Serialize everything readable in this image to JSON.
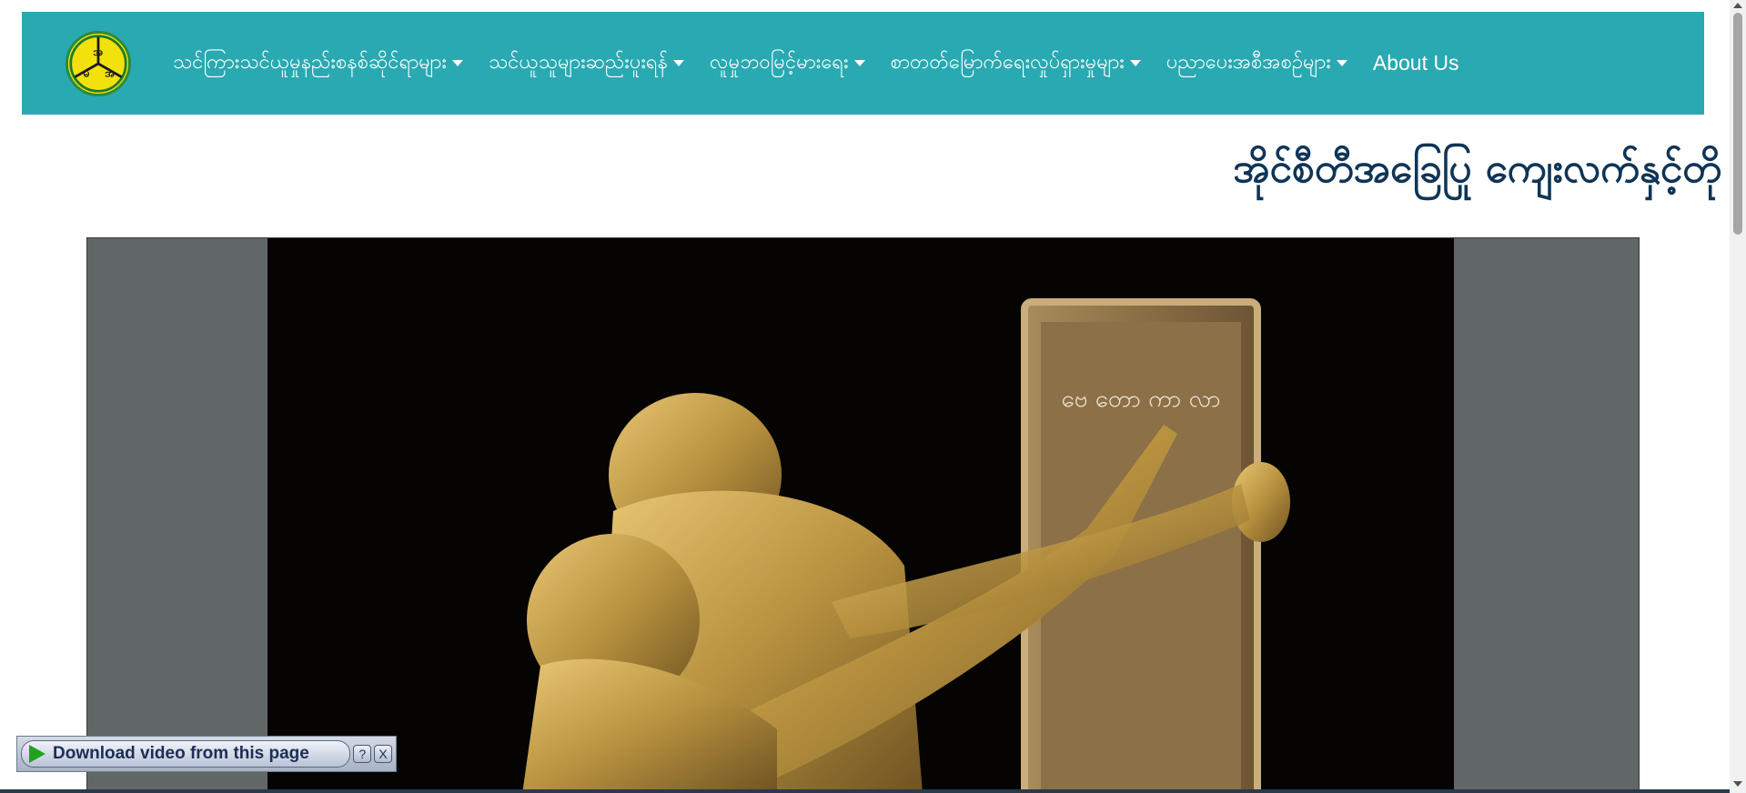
{
  "navbar": {
    "logo_text": "အ မ အ",
    "items": [
      {
        "label": "သင်ကြားသင်ယူမှုနည်းစနစ်ဆိုင်ရာများ"
      },
      {
        "label": "သင်ယူသူများဆည်းပူးရန်"
      },
      {
        "label": "လူမှုဘဝမြင့်မားရေး"
      },
      {
        "label": "စာတတ်မြောက်ရေးလှုပ်ရှားမှုများ"
      },
      {
        "label": "ပညာပေးအစီအစဉ်များ"
      }
    ],
    "about_label": "About Us"
  },
  "page": {
    "title": "အိုင်စီတီအခြေပြု ကျေးလက်နှင့်တို"
  },
  "video": {
    "tablet_text": "ဗေ တော ကာ လာ"
  },
  "download_bar": {
    "label": "Download video from this page",
    "help_label": "?",
    "close_label": "X"
  },
  "colors": {
    "navbar": "#29a9b2",
    "title": "#0f3556",
    "logo_fill": "#f3e10b"
  }
}
